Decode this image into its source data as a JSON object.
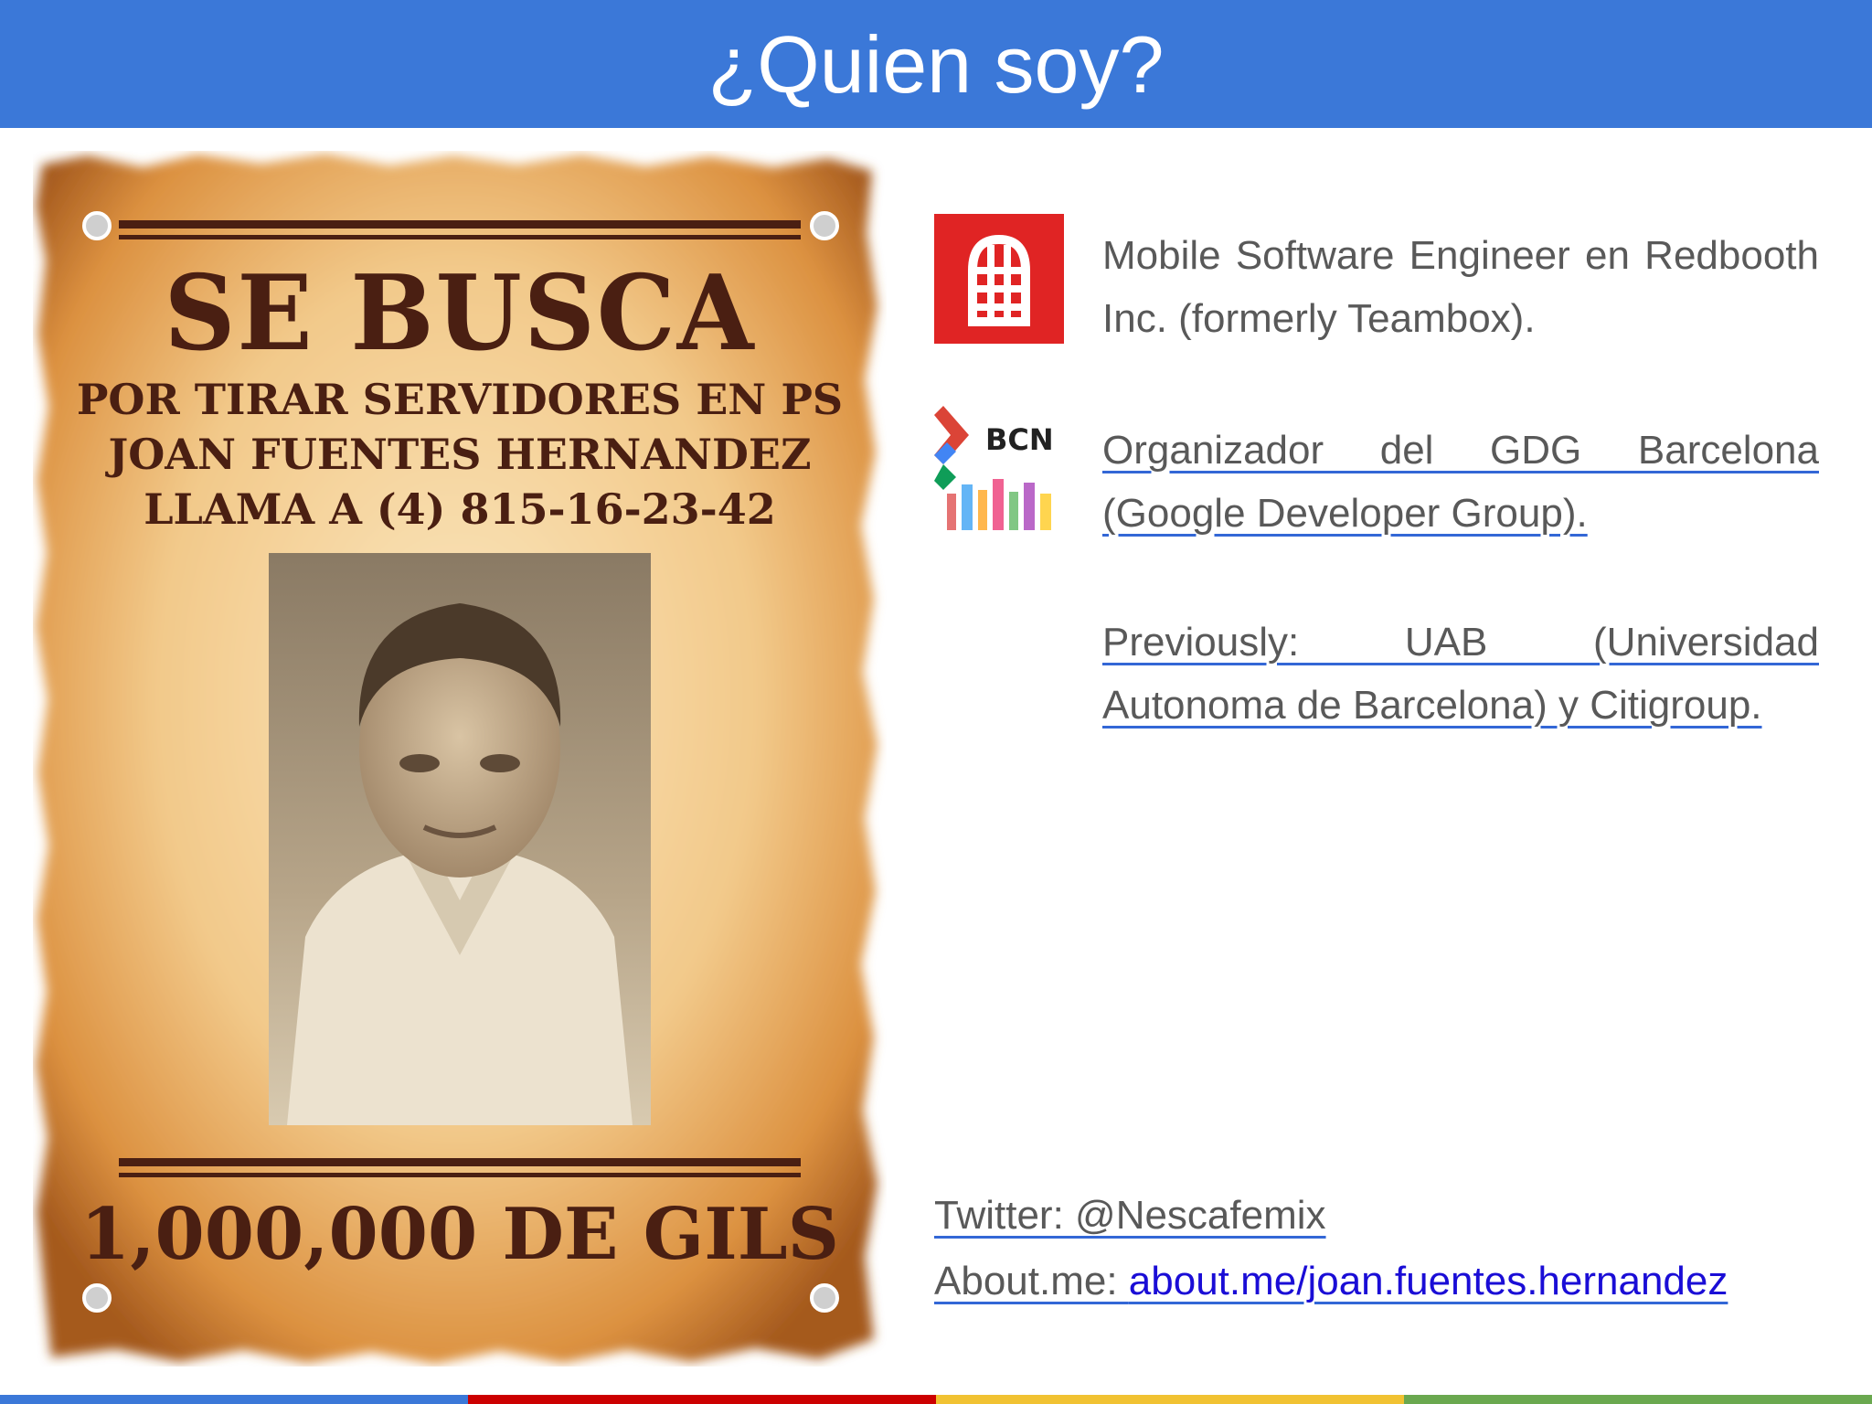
{
  "slide": {
    "title": "¿Quien soy?"
  },
  "poster": {
    "heading": "SE BUSCA",
    "line1": "POR TIRAR SERVIDORES EN PS",
    "line2": "JOAN FUENTES HERNANDEZ",
    "line3": "LLAMA A (4) 815-16-23-42",
    "reward": "1,000,000 DE GILS"
  },
  "items": [
    {
      "icon": "redbooth-logo-icon",
      "text": "Mobile Software Engineer en Redbooth Inc. (formerly Teambox)."
    },
    {
      "icon": "gdg-bcn-logo-icon",
      "logo_text": "BCN",
      "text": "Organizador del GDG Barcelona (Google Developer Group)."
    },
    {
      "text": "Previously: UAB (Universidad Autonoma de Barcelona) y Citigroup."
    }
  ],
  "contact": {
    "twitter": "Twitter: @Nescafemix",
    "aboutme_label": "About.me: ",
    "aboutme_url": "about.me/joan.fuentes.hernandez"
  },
  "colors": {
    "header": "#3b78d8",
    "redbooth": "#e02424",
    "link": "#1a0dd6",
    "bar": [
      "#3b78d8",
      "#cc0000",
      "#f1c232",
      "#6aa84f"
    ]
  }
}
